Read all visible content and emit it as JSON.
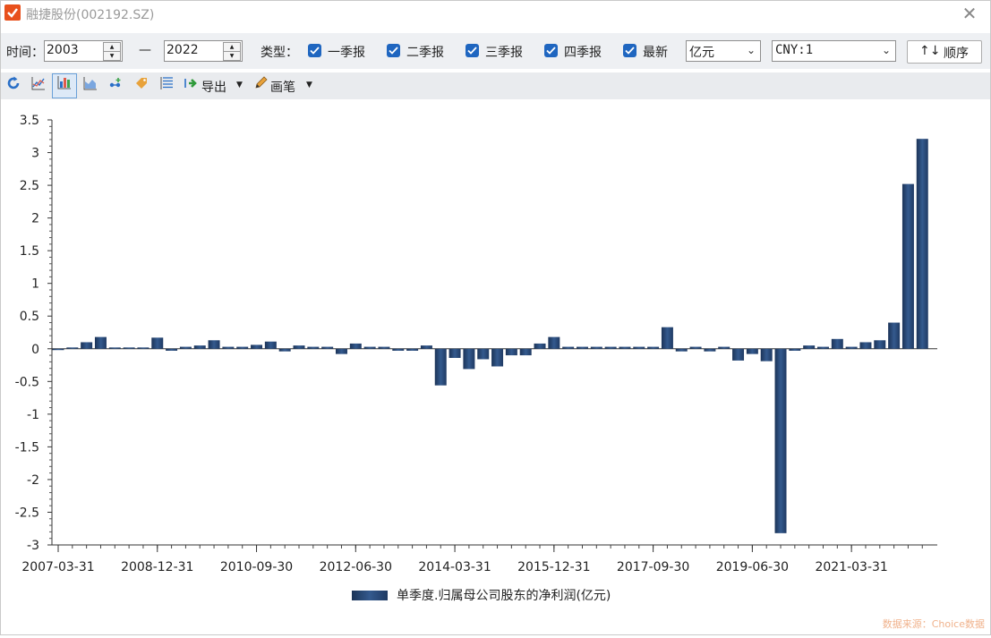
{
  "window": {
    "title": "融捷股份(002192.SZ)",
    "close_glyph": "✕"
  },
  "filters": {
    "time_label": "时间：",
    "start_year": "2003",
    "dash": "—",
    "end_year": "2022",
    "type_label": "类型：",
    "checkboxes": [
      {
        "label": "一季报",
        "checked": true
      },
      {
        "label": "二季报",
        "checked": true
      },
      {
        "label": "三季报",
        "checked": true
      },
      {
        "label": "四季报",
        "checked": true
      },
      {
        "label": "最新",
        "checked": true
      }
    ],
    "unit_select": "亿元",
    "currency_select": "CNY:1",
    "order_button": "顺序",
    "order_arrows": "↑↓"
  },
  "toolbar": {
    "export_label": "导出",
    "pen_label": "画笔",
    "icons": [
      "refresh-icon",
      "line-chart-icon",
      "bar-chart-icon",
      "area-chart-icon",
      "scatter-icon",
      "tag-icon",
      "list-icon",
      "export-icon",
      "pen-icon"
    ]
  },
  "footer": {
    "source": "数据来源：Choice数据"
  },
  "colors": {
    "bar": "#2b4a78",
    "accent": "#1f66c0",
    "brand": "#e8501c"
  },
  "chart_data": {
    "type": "bar",
    "title": "",
    "xlabel": "",
    "ylabel": "",
    "ylim": [
      -3,
      3.5
    ],
    "yticks": [
      3.5,
      3,
      2.5,
      2,
      1.5,
      1,
      0.5,
      0,
      -0.5,
      -1,
      -1.5,
      -2,
      -2.5,
      -3
    ],
    "xtick_labels": [
      "2007-03-31",
      "2008-12-31",
      "2010-09-30",
      "2012-06-30",
      "2014-03-31",
      "2015-12-31",
      "2017-09-30",
      "2019-06-30",
      "2021-03-31"
    ],
    "xtick_indices": [
      0,
      7,
      14,
      21,
      28,
      35,
      42,
      49,
      56
    ],
    "legend": {
      "position": "bottom-center"
    },
    "series": [
      {
        "name": "单季度.归属母公司股东的净利润(亿元)",
        "values": [
          -0.02,
          0.02,
          0.1,
          0.18,
          0.02,
          0.02,
          0.02,
          0.17,
          -0.03,
          0.03,
          0.05,
          0.13,
          0.03,
          0.03,
          0.06,
          0.11,
          -0.04,
          0.05,
          0.03,
          0.03,
          -0.08,
          0.08,
          0.03,
          0.03,
          -0.03,
          -0.03,
          0.05,
          -0.56,
          -0.14,
          -0.31,
          -0.16,
          -0.27,
          -0.1,
          -0.1,
          0.08,
          0.18,
          0.03,
          0.03,
          0.03,
          0.03,
          0.03,
          0.03,
          0.03,
          0.33,
          -0.04,
          0.03,
          -0.04,
          0.03,
          -0.18,
          -0.08,
          -0.19,
          -2.82,
          -0.03,
          0.05,
          0.03,
          0.15,
          0.03,
          0.1,
          0.13,
          0.4,
          2.52,
          3.21
        ]
      }
    ]
  }
}
